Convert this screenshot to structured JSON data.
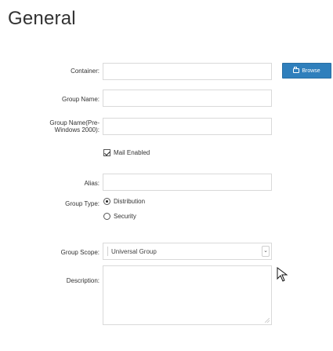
{
  "window": {
    "title": "General"
  },
  "form": {
    "container_label": "Container:",
    "group_name_label": "Group Name:",
    "group_name_pre_label_line1": "Group Name(Pre-",
    "group_name_pre_label_line2": "Windows 2000):",
    "mail_enabled_label": "Mail Enabled",
    "alias_label": "Alias:",
    "group_type_label": "Group Type:",
    "group_type_options": {
      "distribution": "Distribution",
      "security": "Security"
    },
    "group_scope_label": "Group Scope:",
    "group_scope_value": "Universal Group",
    "description_label": "Description:",
    "browse_button_label": "Browse"
  },
  "state": {
    "mail_enabled": true,
    "group_type_selected": "Distribution"
  },
  "icons": {
    "browse": "folder-icon",
    "select_arrow": "chevron-down-icon",
    "cursor": "cursor-arrow-icon"
  },
  "colors": {
    "accent": "#2f7fbc",
    "border": "#d9d9d9",
    "text": "#333333"
  }
}
